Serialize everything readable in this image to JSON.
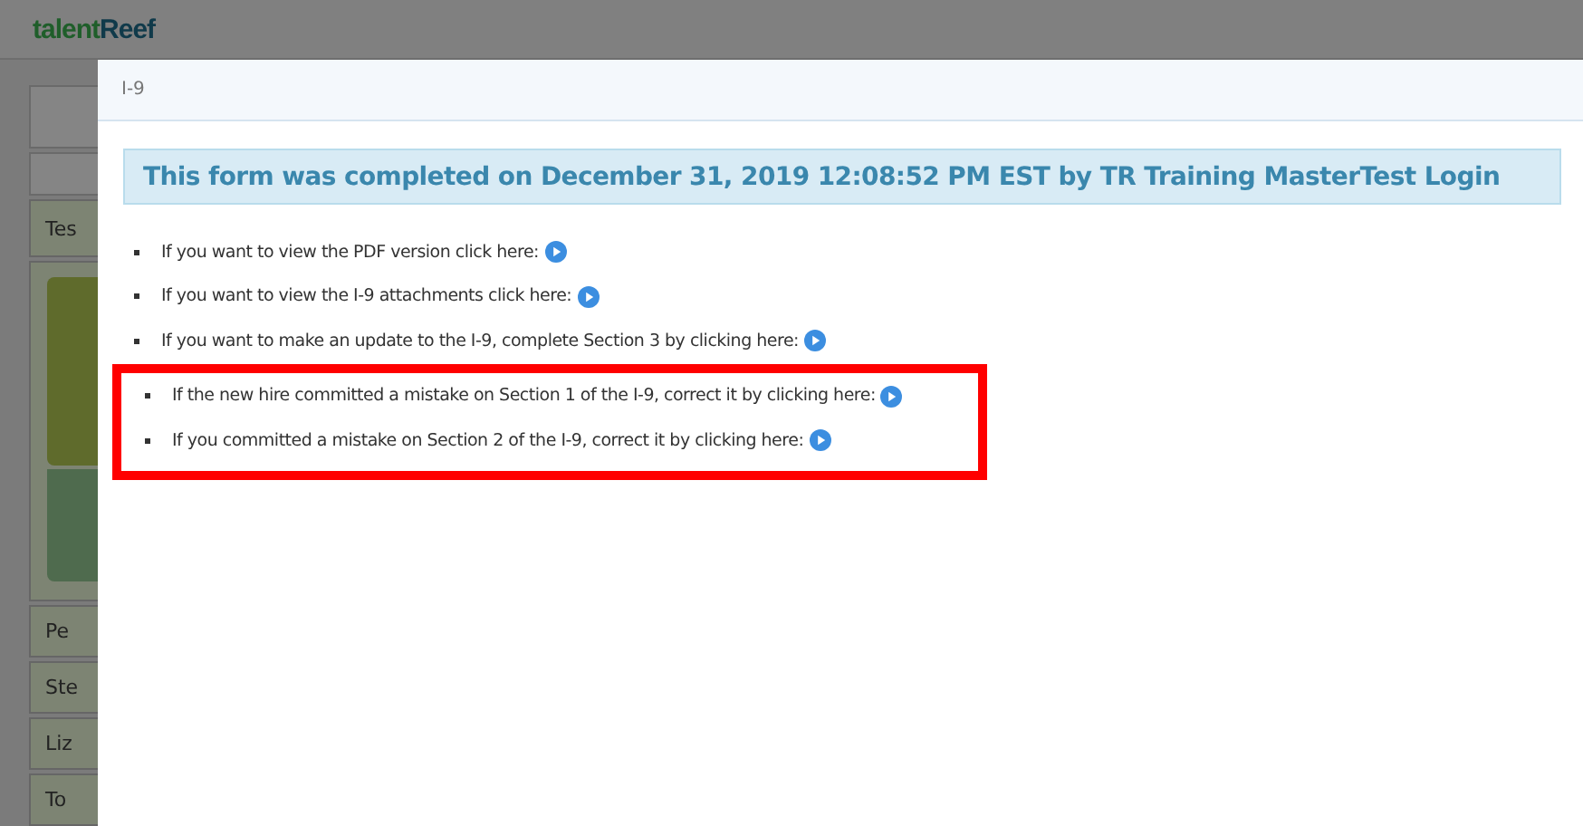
{
  "logo": {
    "first": "talent",
    "second": "Reef"
  },
  "background_panel": {
    "rows": [
      "Tes",
      "Pe",
      "Ste",
      "Liz",
      "To"
    ]
  },
  "dialog": {
    "title": "I-9",
    "banner": "This form was completed on December 31, 2019 12:08:52 PM EST by TR Training MasterTest Login",
    "items": [
      "If you want to view the PDF version click here:",
      "If you want to view the I-9 attachments click here:",
      "If you want to make an update to the I-9, complete Section 3 by clicking here:"
    ],
    "highlighted_items": [
      "If the new hire committed a mistake on Section 1 of the I-9, correct it by clicking here:",
      "If you committed a mistake on Section 2 of the I-9, correct it by clicking here:"
    ]
  }
}
